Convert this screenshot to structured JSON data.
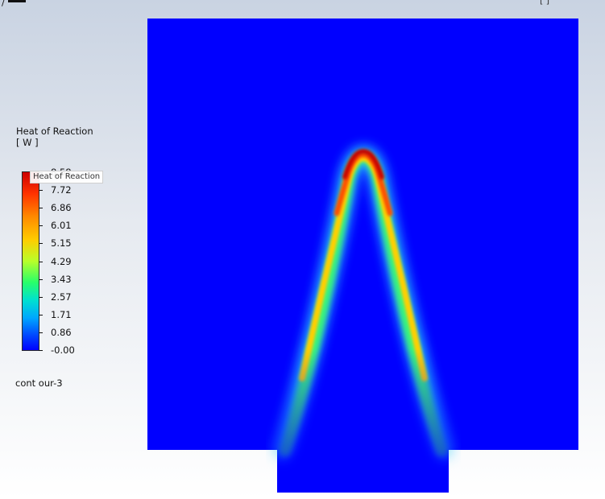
{
  "legend": {
    "title": "Heat of Reaction",
    "unit": "[ W ]",
    "tooltip": "Heat of Reaction",
    "levels": [
      "8.58",
      "7.72",
      "6.86",
      "6.01",
      "5.15",
      "4.29",
      "3.43",
      "2.57",
      "1.71",
      "0.86",
      "-0.00"
    ]
  },
  "contour_name": "cont our-3",
  "colors": {
    "field_background": "#0000ff",
    "flame_peak": "#cc0000",
    "flame_outer": "#ffcc00",
    "flame_edge": "#28ff6a"
  }
}
